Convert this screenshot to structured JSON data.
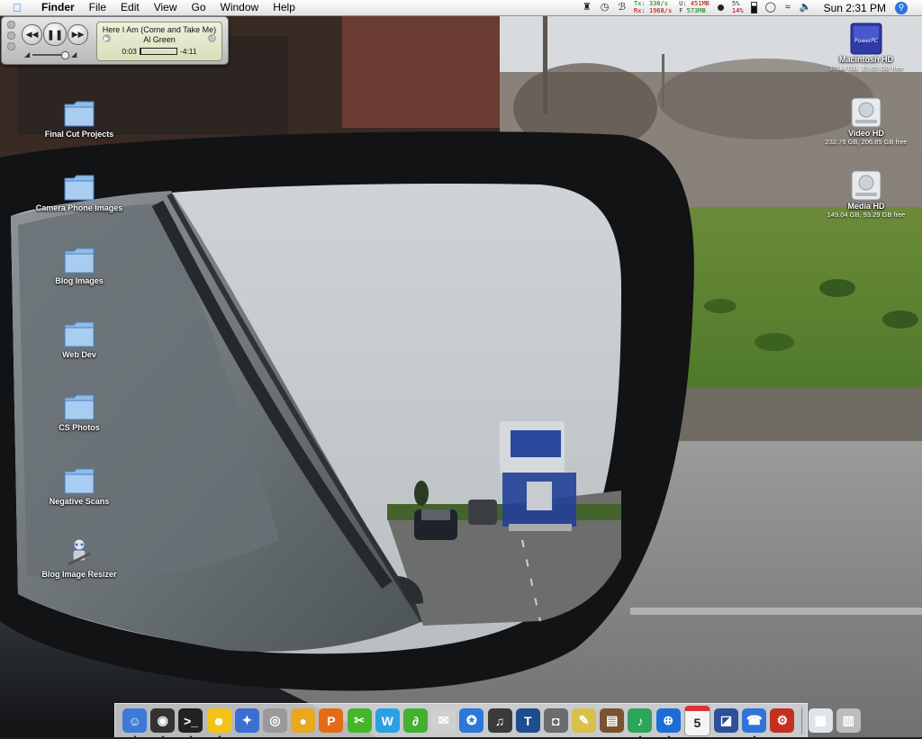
{
  "menubar": {
    "app_name": "Finder",
    "items": [
      "File",
      "Edit",
      "View",
      "Go",
      "Window",
      "Help"
    ],
    "net_tx_label": "Tx:",
    "net_tx_value": "338/s",
    "net_rx_label": "Rx:",
    "net_rx_value": "1968/s",
    "mem_u_label": "U:",
    "mem_u_value": "451MB",
    "mem_f_label": "F",
    "mem_f_value": "573MB",
    "cpu_top": "5%",
    "cpu_bottom": "14%",
    "clock": "Sun 2:31 PM"
  },
  "player": {
    "song": "Here I Am (Come and Take Me)",
    "artist": "Al Green",
    "elapsed": "0:03",
    "remaining": "-4:11",
    "progress": 0.02
  },
  "desktop_left": [
    {
      "label": "Final Cut Projects"
    },
    {
      "label": "Camera Phone Images"
    },
    {
      "label": "Blog Images"
    },
    {
      "label": "Web Dev"
    },
    {
      "label": "CS Photos"
    },
    {
      "label": "Negative Scans"
    },
    {
      "label": "Blog Image Resizer"
    }
  ],
  "desktop_right": [
    {
      "label": "Macintosh HD",
      "sub": "37.14 GB, 15.65 GB free",
      "badge": "PowerPC"
    },
    {
      "label": "Video HD",
      "sub": "232.76 GB, 206.85 GB free"
    },
    {
      "label": "Media HD",
      "sub": "149.04 GB, 93.29 GB free"
    }
  ],
  "dock": {
    "calendar_day": "5",
    "items": [
      {
        "icon": "finder-icon",
        "color": "#3d7ad8",
        "glyph": "☺",
        "running": true
      },
      {
        "icon": "dashboard-icon",
        "color": "#333333",
        "glyph": "◉",
        "running": true
      },
      {
        "icon": "terminal-icon",
        "color": "#222222",
        "glyph": ">_",
        "running": true
      },
      {
        "icon": "adium-icon",
        "color": "#f2c316",
        "glyph": "☻",
        "running": true
      },
      {
        "icon": "imovie-icon",
        "color": "#3b6fd0",
        "glyph": "✦",
        "running": false
      },
      {
        "icon": "iphoto-camera-icon",
        "color": "#9a9a9a",
        "glyph": "◎",
        "running": false
      },
      {
        "icon": "cyberduck-icon",
        "color": "#e8a820",
        "glyph": "●",
        "running": false
      },
      {
        "icon": "photoshop-icon",
        "color": "#e46b16",
        "glyph": "P",
        "running": false
      },
      {
        "icon": "illustrator-icon",
        "color": "#45b52a",
        "glyph": "✂",
        "running": false
      },
      {
        "icon": "dreamweaver-icon",
        "color": "#2aa0e0",
        "glyph": "W",
        "running": false
      },
      {
        "icon": "golive-icon",
        "color": "#43b030",
        "glyph": "∂",
        "running": false
      },
      {
        "icon": "transmit-icon",
        "color": "#cfcfcf",
        "glyph": "✉",
        "running": false
      },
      {
        "icon": "safari-globe-icon",
        "color": "#2b78d8",
        "glyph": "✪",
        "running": false
      },
      {
        "icon": "garageband-icon",
        "color": "#3a3a3a",
        "glyph": "♫",
        "running": false
      },
      {
        "icon": "textedit-icon",
        "color": "#1d4d8d",
        "glyph": "T",
        "running": false
      },
      {
        "icon": "image-capture-icon",
        "color": "#6c6c6c",
        "glyph": "◘",
        "running": false
      },
      {
        "icon": "brush-icon",
        "color": "#d8c04a",
        "glyph": "✎",
        "running": false
      },
      {
        "icon": "preview-icon",
        "color": "#7b5230",
        "glyph": "▤",
        "running": false
      },
      {
        "icon": "itunes-icon",
        "color": "#2aa55a",
        "glyph": "♪",
        "running": true
      },
      {
        "icon": "safari-icon",
        "color": "#1c6ed6",
        "glyph": "⊕",
        "running": true
      },
      {
        "icon": "ical-icon",
        "color": "#f4f4f4",
        "glyph": "",
        "running": false
      },
      {
        "icon": "photo-booth-icon",
        "color": "#2e4f9c",
        "glyph": "◪",
        "running": false
      },
      {
        "icon": "ichat-icon",
        "color": "#2f74da",
        "glyph": "☎",
        "running": true
      },
      {
        "icon": "automator-icon",
        "color": "#c33020",
        "glyph": "⚙",
        "running": false
      },
      {
        "icon": "sep",
        "color": "",
        "glyph": "",
        "running": false
      },
      {
        "icon": "downloads-stack-icon",
        "color": "#e0e4ea",
        "glyph": "▦",
        "running": false
      },
      {
        "icon": "trash-icon",
        "color": "#bdbdbd",
        "glyph": "▥",
        "running": false
      }
    ]
  },
  "colors": {
    "accent": "#2a72e0",
    "icon_label": "#ffffff",
    "net_green": "#0a7a0a",
    "net_red": "#bb0000"
  }
}
